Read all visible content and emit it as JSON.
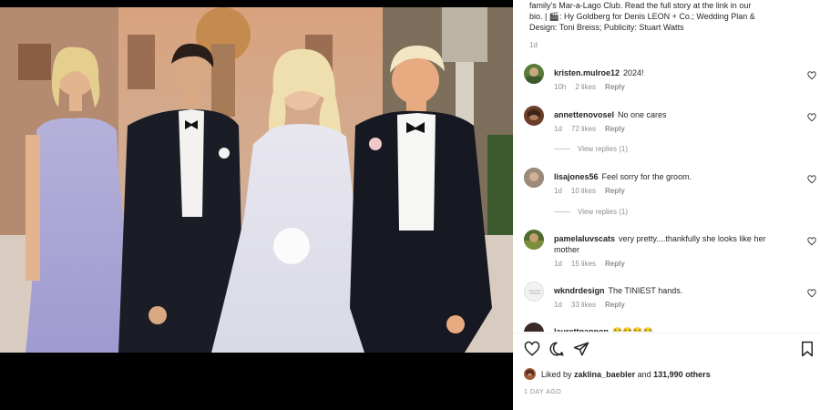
{
  "post": {
    "caption_line1": "family's Mar-a-Lago Club. Read the full story at the link in our",
    "caption_line2": "bio. | 🎬: Hy Goldberg for Denis LEON + Co.; Wedding Plan &",
    "caption_line3": "Design: Toni Breiss; Publicity: Stuart Watts",
    "caption_time": "1d"
  },
  "comments": [
    {
      "user": "kristen.mulroe12",
      "text": "2024!",
      "time": "10h",
      "likes": "2 likes",
      "reply": "Reply",
      "avatar_color": "#5a7a3a"
    },
    {
      "user": "annettenovosel",
      "text": "No one cares",
      "time": "1d",
      "likes": "72 likes",
      "reply": "Reply",
      "view_replies": "View replies (1)",
      "avatar_color": "#6b3e2a"
    },
    {
      "user": "lisajones56",
      "text": "Feel sorry for the groom.",
      "time": "1d",
      "likes": "10 likes",
      "reply": "Reply",
      "view_replies": "View replies (1)",
      "avatar_color": "#7d6a5c"
    },
    {
      "user": "pamelaluvscats",
      "text": "very pretty....thankfully she looks like her",
      "text2": "mother",
      "time": "1d",
      "likes": "15 likes",
      "reply": "Reply",
      "avatar_color": "#4f6b2e"
    },
    {
      "user": "wkndrdesign",
      "text": "The TINIEST hands.",
      "time": "1d",
      "likes": "33 likes",
      "reply": "Reply",
      "avatar_color": "#e8e8e8"
    },
    {
      "user": "laurettgannon",
      "text": "😂😂😂😂",
      "avatar_color": "#3a2a2a"
    }
  ],
  "actions": {
    "like_icon": "heart-outline-icon",
    "comment_icon": "comment-bubble-icon",
    "share_icon": "paper-plane-icon",
    "save_icon": "bookmark-icon"
  },
  "likes": {
    "prefix": "Liked by",
    "user": "zaklina_baebler",
    "middle": "and",
    "others": "131,990 others"
  },
  "post_time": "1 DAY AGO"
}
